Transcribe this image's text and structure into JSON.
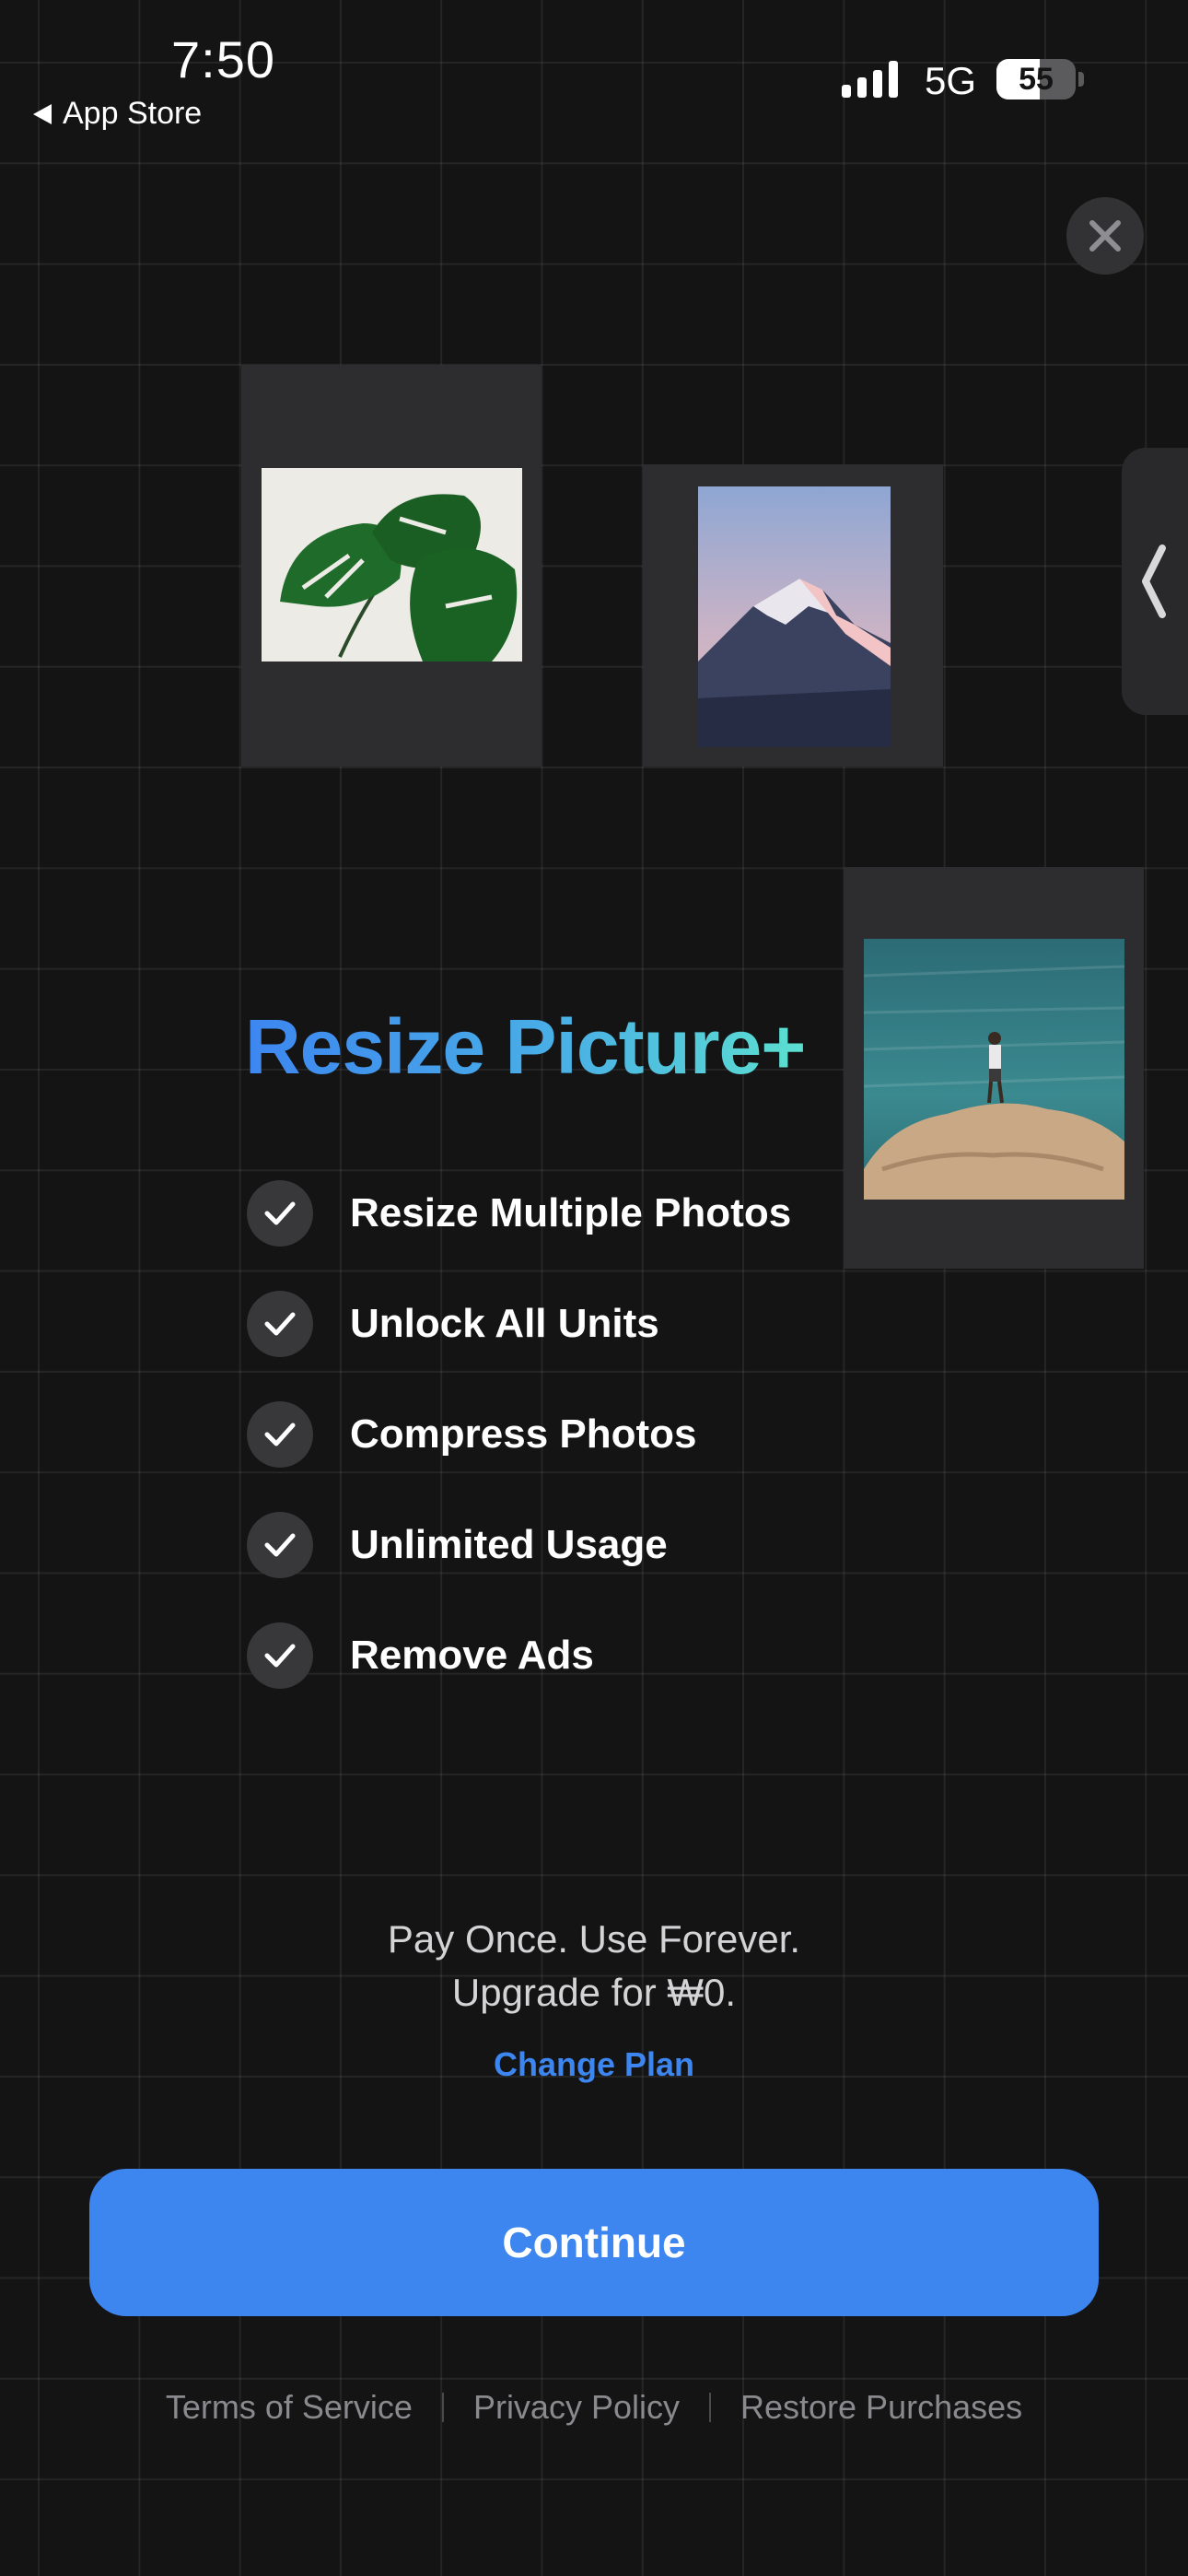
{
  "status_bar": {
    "time": "7:50",
    "back_label": "App Store",
    "network": "5G",
    "battery": "55",
    "battery_level": 0.55
  },
  "hero": {
    "title": "Resize Picture+",
    "photos": [
      "monstera-plant-photo",
      "mountain-peak-photo",
      "person-on-coastal-rock-photo"
    ]
  },
  "features": [
    {
      "label": "Resize Multiple Photos"
    },
    {
      "label": "Unlock All Units"
    },
    {
      "label": "Compress Photos"
    },
    {
      "label": "Unlimited Usage"
    },
    {
      "label": "Remove Ads"
    }
  ],
  "pricing": {
    "line1": "Pay Once. Use Forever.",
    "line2": "Upgrade for ₩0.",
    "change_plan": "Change Plan"
  },
  "cta": {
    "label": "Continue"
  },
  "footer": {
    "terms": "Terms of Service",
    "privacy": "Privacy Policy",
    "restore": "Restore Purchases"
  },
  "colors": {
    "background": "#141415",
    "accent": "#3d86f0",
    "gradient_end": "#5ce0d0"
  }
}
